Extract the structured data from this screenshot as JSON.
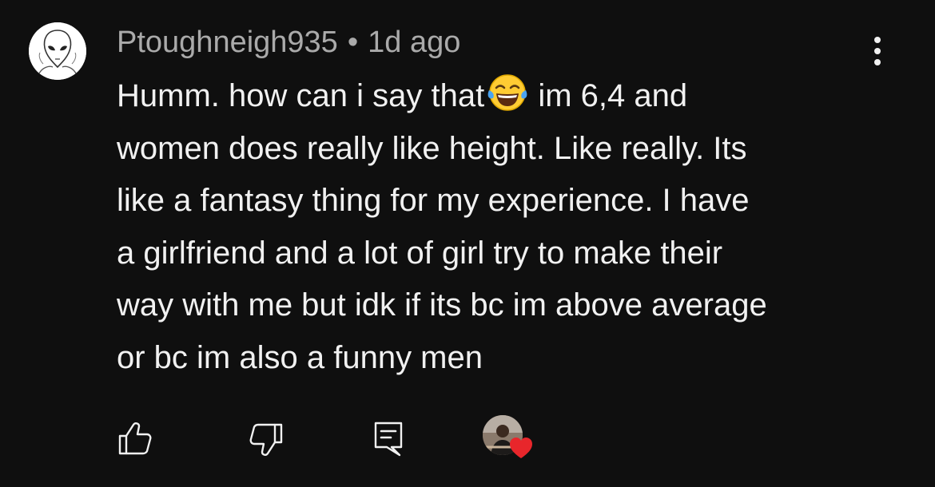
{
  "comment": {
    "username": "Ptoughneigh935",
    "separator": "•",
    "timestamp": "1d ago",
    "lines": [
      "Humm. how can i say that",
      "im 6,4 and",
      "women does really like height. Like really. Its",
      "like a fantasy thing for my experience. I have",
      "a girlfriend and a lot of girl try to make their",
      "way with me but idk if its bc im above average",
      "or bc im also a funny men"
    ],
    "emoji": "laughing-face-with-tears-emoji"
  },
  "actions": {
    "like_icon": "thumbs-up-icon",
    "dislike_icon": "thumbs-down-icon",
    "reply_icon": "reply-comment-icon",
    "more_icon": "more-vertical-icon",
    "creator_heart_icon": "heart-icon"
  },
  "colors": {
    "background": "#0f0f0f",
    "text": "#f1f1f1",
    "secondary_text": "#aaaaaa",
    "heart": "#e8262b"
  }
}
